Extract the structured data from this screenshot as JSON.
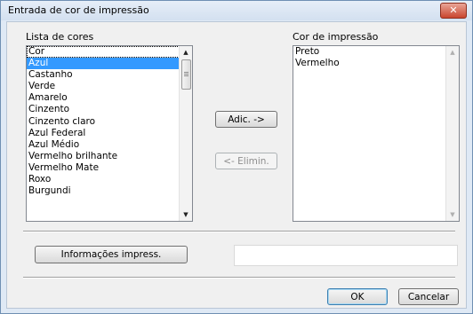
{
  "window": {
    "title": "Entrada de cor de impressão",
    "close_label": "✕"
  },
  "color_list": {
    "label": "Lista de cores",
    "items": [
      "Cor",
      "Azul",
      "Castanho",
      "Verde",
      "Amarelo",
      "Cinzento",
      "Cinzento claro",
      "Azul Federal",
      "Azul Médio",
      "Vermelho brilhante",
      "Vermelho Mate",
      "Roxo",
      "Burgundi"
    ],
    "selected": "Azul",
    "focused": "Cor"
  },
  "print_list": {
    "label": "Cor de impressão",
    "items": [
      "Preto",
      "Vermelho"
    ]
  },
  "buttons": {
    "add": "Adic. ->",
    "remove": "<- Elimin.",
    "print_info": "Informações impress.",
    "ok": "OK",
    "cancel": "Cancelar"
  },
  "scroll_icons": {
    "up": "▲",
    "down": "▼"
  }
}
